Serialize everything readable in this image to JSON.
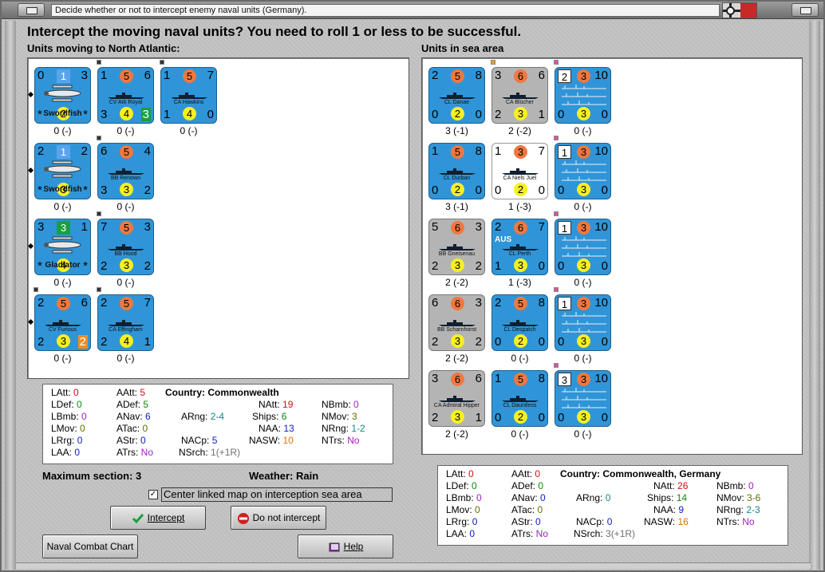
{
  "window": {
    "title": "Decide whether or not to intercept enemy naval units (Germany)."
  },
  "headline": "Intercept the moving naval units?  You need to roll 1 or less to be successful.",
  "left_panel": {
    "label": "Units moving to North Atlantic:",
    "units": [
      {
        "name": "Swordfish",
        "tl": "0",
        "tm": "1",
        "tr": "3",
        "bm": "2",
        "bl": "*",
        "br": "*",
        "status": "0 (-)"
      },
      {
        "name": "CV Ark Royal",
        "tl": "1",
        "tm": "5",
        "tr": "6",
        "bl": "3",
        "bm": "4",
        "br": "3",
        "status": "0 (-)"
      },
      {
        "name": "CA Hawkins",
        "tl": "1",
        "tm": "5",
        "tr": "7",
        "bl": "1",
        "bm": "4",
        "br": "0",
        "status": "0 (-)"
      },
      {
        "name": "Swordfish",
        "tl": "2",
        "tm": "1",
        "tr": "2",
        "bm": "3",
        "bl": "*",
        "br": "*",
        "status": "0 (-)"
      },
      {
        "name": "BB Renown",
        "tl": "6",
        "tm": "5",
        "tr": "4",
        "bl": "3",
        "bm": "3",
        "br": "2",
        "status": "0 (-)"
      },
      {
        "name": "Gladiator",
        "tl": "3",
        "tm": "3",
        "tr": "1",
        "bm": "4",
        "bl": "*",
        "br": "*",
        "status": "0 (-)"
      },
      {
        "name": "BB Hood",
        "tl": "7",
        "tm": "5",
        "tr": "3",
        "bl": "2",
        "bm": "3",
        "br": "2",
        "status": "0 (-)"
      },
      {
        "name": "CV Furious",
        "tl": "2",
        "tm": "5",
        "tr": "6",
        "bl": "2",
        "bm": "3",
        "br": "2",
        "status": "0 (-)"
      },
      {
        "name": "CA Effingham",
        "tl": "2",
        "tm": "5",
        "tr": "7",
        "bl": "2",
        "bm": "4",
        "br": "1",
        "status": "0 (-)"
      }
    ]
  },
  "right_panel": {
    "label": "Units in sea area",
    "units": [
      {
        "name": "CL Danae",
        "tl": "2",
        "tm": "5",
        "tr": "8",
        "bl": "0",
        "bm": "2",
        "br": "0",
        "status": "3 (-1)"
      },
      {
        "name": "CA Blücher",
        "tl": "3",
        "tm": "6",
        "tr": "6",
        "bl": "2",
        "bm": "3",
        "br": "1",
        "status": "2 (-2)"
      },
      {
        "name": "",
        "tl": "",
        "tm": "2",
        "tm2": "3",
        "tr": "10",
        "bl": "0",
        "bm": "3",
        "br": "0",
        "status": "0 (-)"
      },
      {
        "name": "CL Durban",
        "tl": "1",
        "tm": "5",
        "tr": "8",
        "bl": "0",
        "bm": "2",
        "br": "0",
        "status": "3 (-1)"
      },
      {
        "name": "CA Niels Juel",
        "tl": "1",
        "tm": "3",
        "tr": "7",
        "bl": "0",
        "bm": "2",
        "br": "0",
        "status": "1 (-3)"
      },
      {
        "name": "",
        "tm": "1",
        "tm2": "3",
        "tr": "10",
        "bl": "0",
        "bm": "3",
        "br": "0",
        "status": "0 (-)"
      },
      {
        "name": "BB Gneisenau",
        "tl": "5",
        "tm": "6",
        "tr": "3",
        "bl": "2",
        "bm": "3",
        "br": "2",
        "status": "2 (-2)"
      },
      {
        "name": "CL Perth",
        "badge": "AUS",
        "tl": "2",
        "tm": "6",
        "tr": "7",
        "bl": "1",
        "bm": "3",
        "br": "0",
        "status": "1 (-3)"
      },
      {
        "name": "",
        "tm": "1",
        "tm2": "3",
        "tr": "10",
        "bl": "0",
        "bm": "3",
        "br": "0",
        "status": "0 (-)"
      },
      {
        "name": "BB Scharnhorst",
        "tl": "6",
        "tm": "6",
        "tr": "3",
        "bl": "2",
        "bm": "3",
        "br": "2",
        "status": "2 (-2)"
      },
      {
        "name": "CL Despatch",
        "tl": "2",
        "tm": "5",
        "tr": "8",
        "bl": "0",
        "bm": "2",
        "br": "0",
        "status": "0 (-)"
      },
      {
        "name": "",
        "tm": "1",
        "tm2": "3",
        "tr": "10",
        "bl": "0",
        "bm": "3",
        "br": "0",
        "status": "0 (-)"
      },
      {
        "name": "CA Admiral Hipper",
        "tl": "3",
        "tm": "6",
        "tr": "6",
        "bl": "2",
        "bm": "3",
        "br": "1",
        "status": "2 (-2)"
      },
      {
        "name": "CL Dauntless",
        "tl": "1",
        "tm": "5",
        "tr": "8",
        "bl": "0",
        "bm": "2",
        "br": "0",
        "status": "0 (-)"
      },
      {
        "name": "",
        "tm": "3",
        "tm2": "3",
        "tr": "10",
        "bl": "0",
        "bm": "3",
        "br": "0",
        "status": "0 (-)"
      }
    ]
  },
  "left_stats": {
    "country_label": "Country:",
    "country": "Commonwealth",
    "LAtt": "0",
    "LDef": "0",
    "LBmb": "0",
    "LMov": "0",
    "LRrg": "0",
    "LAA": "0",
    "AAtt": "5",
    "ADef": "5",
    "ANav": "6",
    "ATac": "0",
    "AStr": "0",
    "ATrs": "No",
    "ARng": "2-4",
    "NACp": "5",
    "NSrch": "1(+1R)",
    "NAtt": "19",
    "Ships": "6",
    "NAA": "13",
    "NASW": "10",
    "NBmb": "0",
    "NMov": "3",
    "NRng": "1-2",
    "NTrs": "No"
  },
  "right_stats": {
    "country_label": "Country:",
    "country": "Commonwealth, Germany",
    "LAtt": "0",
    "LDef": "0",
    "LBmb": "0",
    "LMov": "0",
    "LRrg": "0",
    "LAA": "0",
    "AAtt": "0",
    "ADef": "0",
    "ANav": "0",
    "ATac": "0",
    "AStr": "0",
    "ATrs": "No",
    "ARng": "0",
    "NACp": "0",
    "NSrch": "3(+1R)",
    "NAtt": "26",
    "Ships": "14",
    "NAA": "9",
    "NASW": "16",
    "NBmb": "0",
    "NMov": "3-6",
    "NRng": "2-3",
    "NTrs": "No"
  },
  "info": {
    "max_section": "Maximum section: 3",
    "weather": "Weather:  Rain"
  },
  "checkbox": {
    "label": "Center linked map on interception sea area",
    "checked": "✓"
  },
  "buttons": {
    "intercept": "Intercept",
    "do_not_intercept": "Do not intercept",
    "naval_combat_chart": "Naval Combat Chart",
    "help": "Help"
  },
  "colors": {
    "counter_blue": "#2f95d8",
    "counter_grey": "#b4b4b4",
    "attack_circle": "#f07840",
    "defense_circle": "#f8f020"
  }
}
